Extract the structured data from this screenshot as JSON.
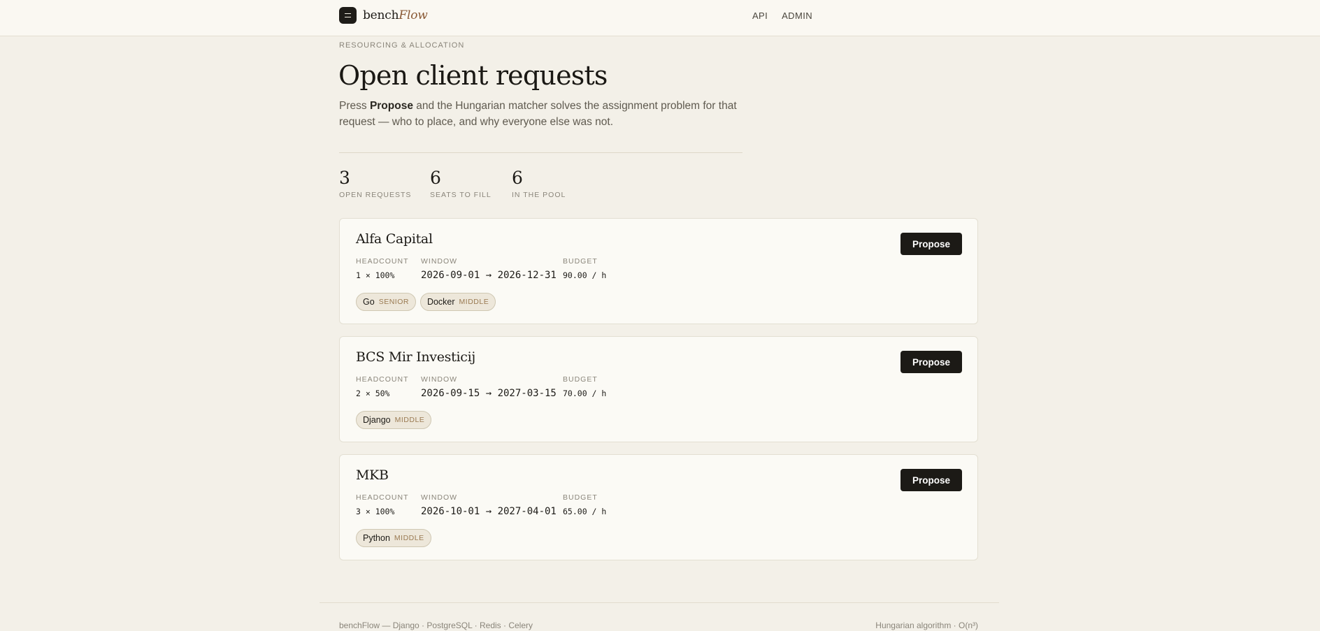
{
  "brand": {
    "name": "bench",
    "name_em": "Flow"
  },
  "nav": [
    {
      "label": "API"
    },
    {
      "label": "ADMIN"
    }
  ],
  "header": {
    "eyebrow": "RESOURCING & ALLOCATION",
    "title": "Open client requests",
    "lede_pre": "Press ",
    "lede_bold": "Propose",
    "lede_post": " and the Hungarian matcher solves the assignment problem for that request — who to place, and why everyone else was not."
  },
  "stats": [
    {
      "value": "3",
      "label": "OPEN REQUESTS"
    },
    {
      "value": "6",
      "label": "SEATS TO FILL"
    },
    {
      "value": "6",
      "label": "IN THE POOL"
    }
  ],
  "labels": {
    "headcount": "HEADCOUNT",
    "window": "WINDOW",
    "budget": "BUDGET",
    "propose": "Propose"
  },
  "requests": [
    {
      "client": "Alfa Capital",
      "headcount": "1 × 100%",
      "window": "2026-09-01 → 2026-12-31",
      "budget": "90.00 / h",
      "skills": [
        {
          "skill": "Go",
          "level": "SENIOR"
        },
        {
          "skill": "Docker",
          "level": "MIDDLE"
        }
      ]
    },
    {
      "client": "BCS Mir Investicij",
      "headcount": "2 × 50%",
      "window": "2026-09-15 → 2027-03-15",
      "budget": "70.00 / h",
      "skills": [
        {
          "skill": "Django",
          "level": "MIDDLE"
        }
      ]
    },
    {
      "client": "MKB",
      "headcount": "3 × 100%",
      "window": "2026-10-01 → 2027-04-01",
      "budget": "65.00 / h",
      "skills": [
        {
          "skill": "Python",
          "level": "MIDDLE"
        }
      ]
    }
  ],
  "footer": {
    "left": "benchFlow — Django · PostgreSQL · Redis · Celery",
    "right": "Hungarian algorithm · O(n³)"
  }
}
